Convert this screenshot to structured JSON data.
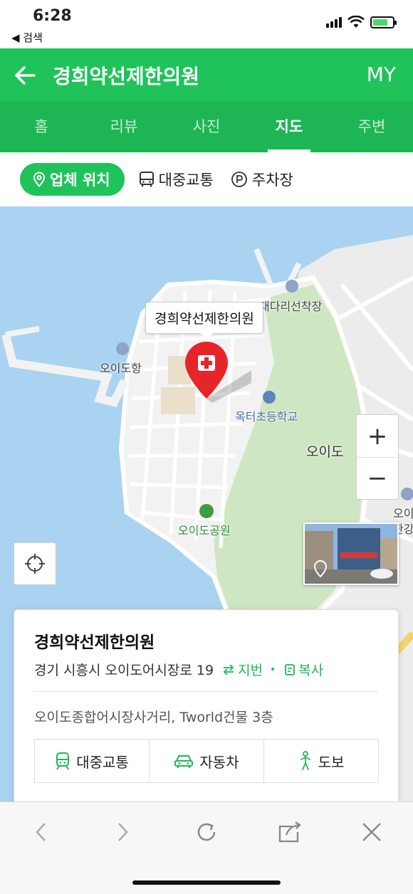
{
  "status": {
    "time": "6:28",
    "back_label": "◀ 검색"
  },
  "header": {
    "title": "경희약선제한의원",
    "my": "MY"
  },
  "tabs": [
    {
      "label": "홈",
      "active": false
    },
    {
      "label": "리뷰",
      "active": false
    },
    {
      "label": "사진",
      "active": false
    },
    {
      "label": "지도",
      "active": true
    },
    {
      "label": "주변",
      "active": false
    }
  ],
  "subtabs": {
    "location": "업체 위치",
    "transit": "대중교통",
    "parking": "주차장"
  },
  "map": {
    "callout": "경희약선제한의원",
    "labels": {
      "pier": "대다리선착장",
      "port": "오이도항",
      "school": "옥터초등학교",
      "island": "오이도",
      "park": "오이도공원",
      "edge1": "오이",
      "edge2": "한강"
    },
    "zoom_in": "+",
    "zoom_out": "−"
  },
  "card": {
    "title": "경희약선제한의원",
    "address": "경기 시흥시 오이도어시장로 19",
    "jibun": "지번",
    "copy": "복사",
    "detail": "오이도종합어시장사거리, Tworld건물 3층",
    "actions": {
      "transit": "대중교통",
      "car": "자동차",
      "walk": "도보"
    }
  },
  "colors": {
    "brand_green": "#1fc35a",
    "tab_green": "#1eb654",
    "marker_red": "#e8242b",
    "water": "#a9d3f0",
    "park": "#cfe6c2"
  }
}
